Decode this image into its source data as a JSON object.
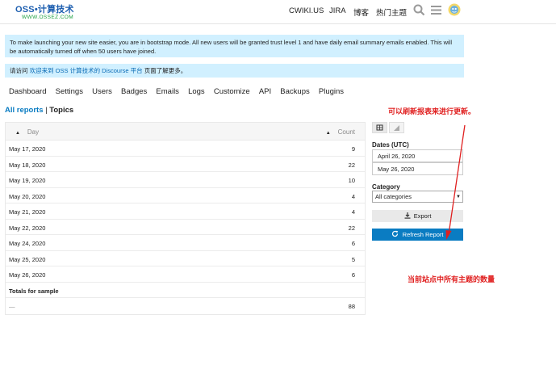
{
  "header": {
    "logo_main": "OSS•计算技术",
    "logo_sub": "WWW.OSSEZ.COM",
    "nav": [
      "CWIKI.US",
      "JIRA",
      "博客",
      "热门主题"
    ]
  },
  "banners": {
    "bootstrap": "To make launching your new site easier, you are in bootstrap mode. All new users will be granted trust level 1 and have daily email summary emails enabled. This will be automatically turned off when 50 users have joined.",
    "welcome_prefix": "请访问 ",
    "welcome_link": "欢迎来到 OSS 计算技术的 Discourse 平台",
    "welcome_suffix": " 页面了解更多。"
  },
  "admin_nav": [
    "Dashboard",
    "Settings",
    "Users",
    "Badges",
    "Emails",
    "Logs",
    "Customize",
    "API",
    "Backups",
    "Plugins"
  ],
  "breadcrumb": {
    "all_reports": "All reports",
    "sep": " | ",
    "current": "Topics"
  },
  "table": {
    "col_day": "Day",
    "col_count": "Count",
    "rows": [
      {
        "day": "May 17, 2020",
        "count": "9"
      },
      {
        "day": "May 18, 2020",
        "count": "22"
      },
      {
        "day": "May 19, 2020",
        "count": "10"
      },
      {
        "day": "May 20, 2020",
        "count": "4"
      },
      {
        "day": "May 21, 2020",
        "count": "4"
      },
      {
        "day": "May 22, 2020",
        "count": "22"
      },
      {
        "day": "May 24, 2020",
        "count": "6"
      },
      {
        "day": "May 25, 2020",
        "count": "5"
      },
      {
        "day": "May 26, 2020",
        "count": "6"
      }
    ],
    "totals_label": "Totals for sample",
    "totals_dash": "—",
    "totals_value": "88"
  },
  "filters": {
    "dates_label": "Dates (UTC)",
    "start_date": "April 26, 2020",
    "end_date": "May 26, 2020",
    "category_label": "Category",
    "category_value": "All categories",
    "export_label": "Export",
    "refresh_label": "Refresh Report"
  },
  "annotations": {
    "top": "可以刷新报表来进行更新。",
    "bottom": "当前站点中所有主题的数量",
    "color": "#e02020"
  }
}
